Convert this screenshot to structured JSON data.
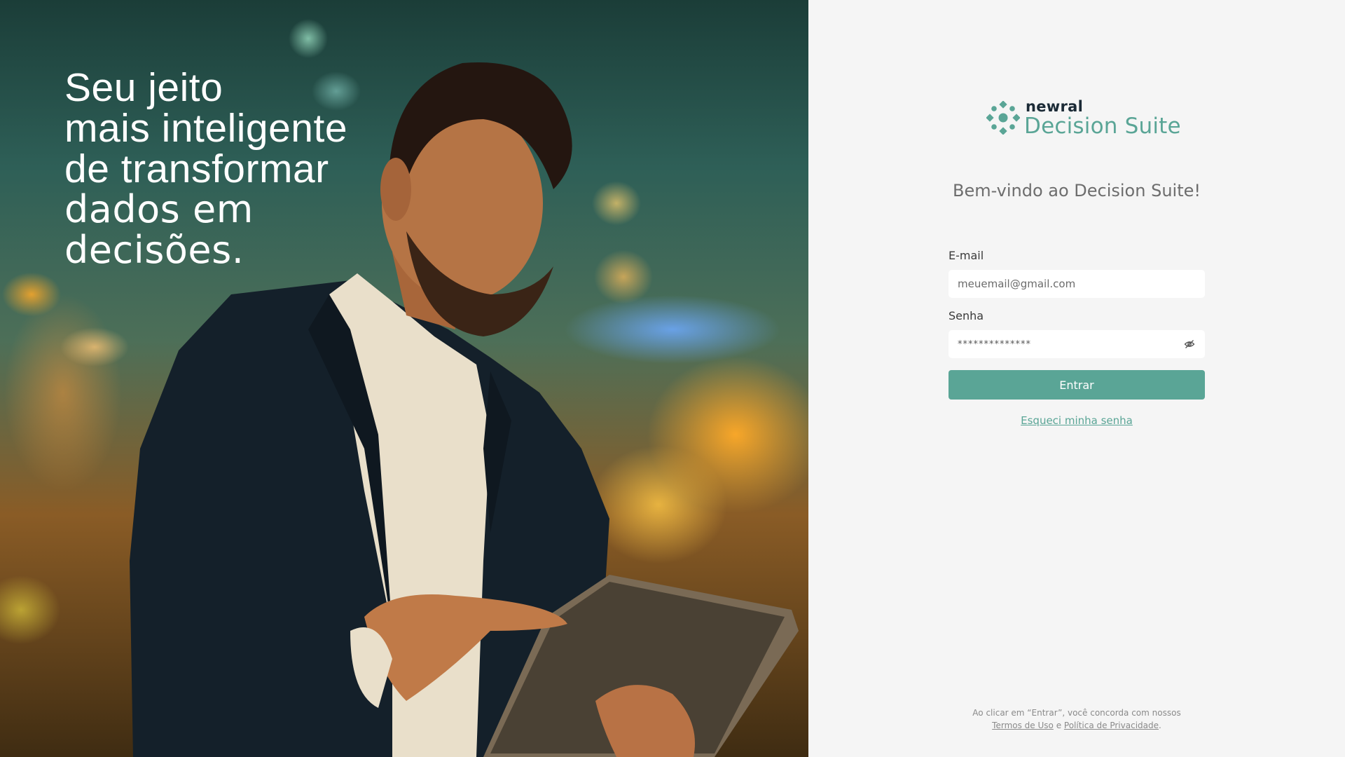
{
  "hero": {
    "lines_light": [
      "Seu jeito",
      "mais inteligente",
      "de transformar"
    ],
    "lines_bold": [
      "dados em",
      "decisões."
    ]
  },
  "brand": {
    "top": "newral",
    "bottom": "Decision Suite",
    "color": "#5aa596",
    "logo_icon": "dotted-circle-logo-icon"
  },
  "login": {
    "welcome": "Bem-vindo ao Decision Suite!",
    "email_label": "E-mail",
    "email_placeholder": "meuemail@gmail.com",
    "password_label": "Senha",
    "password_value": "**************",
    "password_toggle_icon": "eye-off-icon",
    "submit_label": "Entrar",
    "forgot_label": "Esqueci minha senha"
  },
  "legal": {
    "prefix": "Ao clicar em “Entrar”, você concorda com nossos",
    "terms": "Termos de Uso",
    "and": "e",
    "privacy": "Política de Privacidade",
    "suffix": "."
  },
  "colors": {
    "accent": "#5aa596",
    "panel_bg": "#f5f5f5",
    "brand_dark": "#1b2a36"
  }
}
